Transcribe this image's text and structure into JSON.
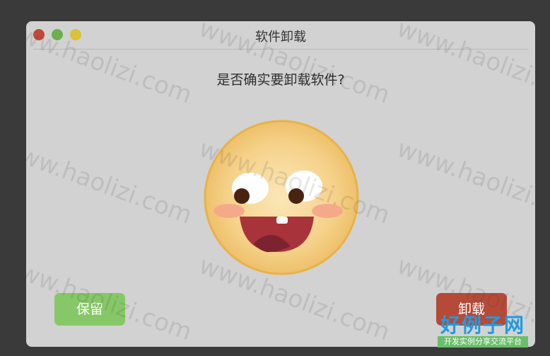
{
  "window": {
    "title": "软件卸载",
    "controls": [
      "close",
      "zoom",
      "minimize"
    ]
  },
  "dialog": {
    "question": "是否确实要卸载软件?",
    "illustration": "laughing-face-emoji"
  },
  "buttons": {
    "keep_label": "保留",
    "uninstall_label": "卸载"
  },
  "watermark": {
    "text": "www.haolizi.com",
    "logo_main": "好例子网",
    "logo_sub": "开发实例分享交流平台"
  },
  "colors": {
    "keep": "#86c867",
    "uninstall": "#b54a38",
    "close": "#bd4b3a",
    "zoom": "#6ab04c",
    "minimize": "#d8c23a"
  }
}
